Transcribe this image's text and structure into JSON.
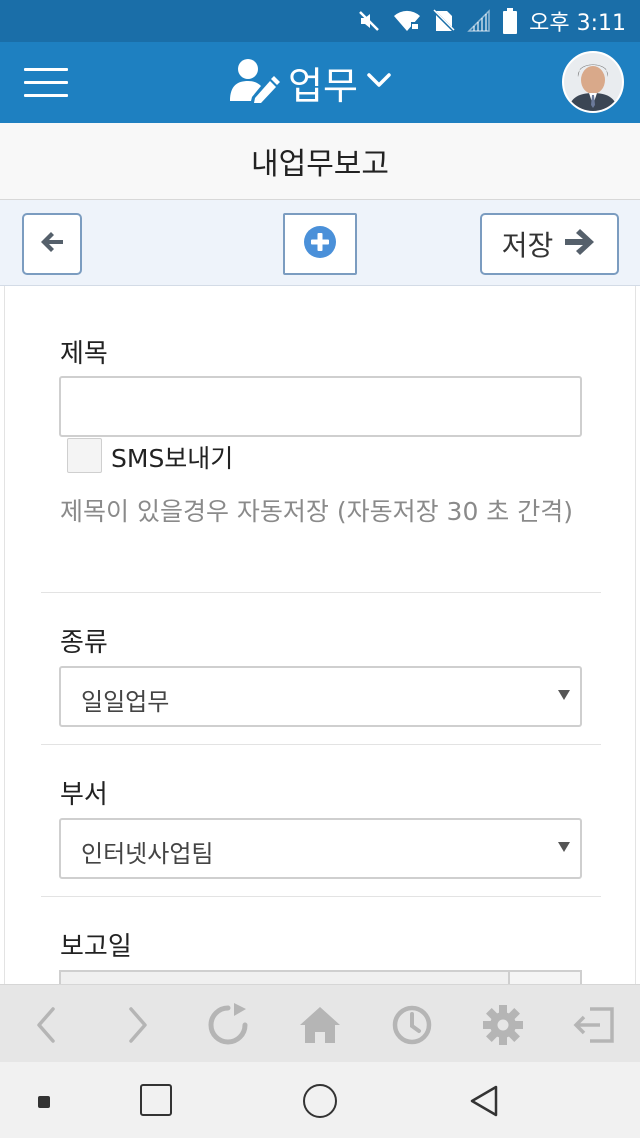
{
  "status_bar": {
    "time": "오후 3:11",
    "icons": [
      "mute-icon",
      "wifi-icon",
      "no-sim-icon",
      "signal-icon",
      "battery-icon"
    ]
  },
  "header": {
    "title": "업무",
    "menu_icon": "hamburger-icon",
    "title_icon": "user-edit-icon",
    "dropdown_icon": "chevron-down-icon",
    "avatar_icon": "avatar"
  },
  "subtitle": "내업무보고",
  "toolbar": {
    "back_icon": "arrow-left-icon",
    "add_icon": "plus-circle-icon",
    "save_label": "저장",
    "save_icon": "arrow-right-icon"
  },
  "form": {
    "title_label": "제목",
    "title_value": "",
    "sms_label": "SMS보내기",
    "sms_checked": false,
    "autosave_hint": "제목이 있을경우 자동저장 (자동저장 30 초 간격)",
    "type_label": "종류",
    "type_value": "일일업무",
    "dept_label": "부서",
    "dept_value": "인터넷사업팀",
    "date_label": "보고일"
  },
  "browser_bar": {
    "icons": [
      "back-icon",
      "forward-icon",
      "reload-icon",
      "home-icon",
      "history-icon",
      "settings-icon",
      "exit-icon"
    ]
  },
  "nav_bar": {
    "icons": [
      "dot-icon",
      "recents-icon",
      "home-circle-icon",
      "back-triangle-icon"
    ]
  },
  "colors": {
    "status_bar": "#1a6ea8",
    "header": "#1e80c1",
    "toolbar_bg": "#eef3fa",
    "button_border": "#7b9cc0",
    "accent_icon": "#4a90d9",
    "browser_bar": "#e6e6e6",
    "nav_bar": "#f1f1f1"
  }
}
